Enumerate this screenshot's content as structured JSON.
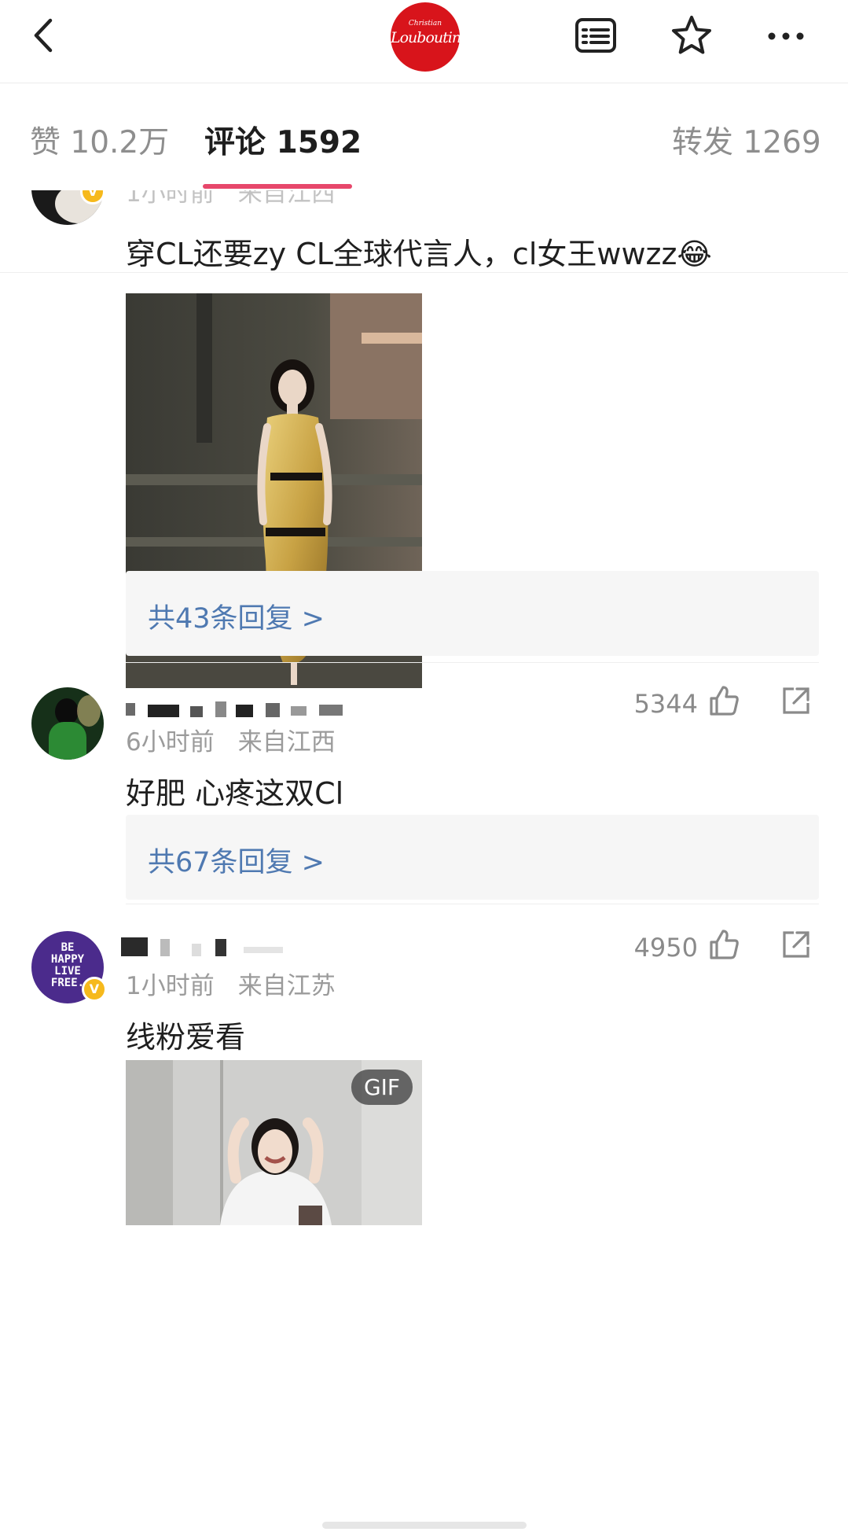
{
  "header": {
    "logo_line1": "Christian",
    "logo_line2": "Louboutin",
    "icons": [
      "back-arrow-icon",
      "list-icon",
      "star-icon",
      "more-icon"
    ]
  },
  "tabs": {
    "likes": "赞 10.2万",
    "comments": "评论 1592",
    "reposts": "转发 1269"
  },
  "comments": [
    {
      "meta_time": "1小时前",
      "meta_location": "来自江西",
      "text": "穿CL还要zy CL全球代言人，cl女王wwzz😂",
      "image": "photo",
      "replies": "共43条回复 >"
    },
    {
      "meta_time": "6小时前",
      "meta_location": "来自江西",
      "likes": "5344",
      "text": "好肥 心疼这双Cl",
      "replies": "共67条回复 >"
    },
    {
      "meta_time": "1小时前",
      "meta_location": "来自江苏",
      "likes": "4950",
      "text": "线粉爱看",
      "image": "gif",
      "image_badge": "GIF",
      "avatar_text": [
        "BE",
        "HAPPY",
        "LIVE",
        "FREE."
      ]
    }
  ],
  "colors": {
    "accent_underline": "#e7476b",
    "reply_link": "#4f79b1",
    "logo_red": "#d8141b",
    "verified_badge": "#f6b91c"
  }
}
